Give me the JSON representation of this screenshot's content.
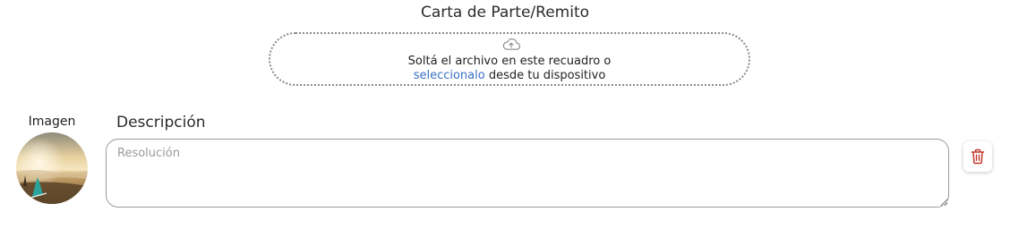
{
  "upload": {
    "title": "Carta de Parte/Remito",
    "icon": "cloud-upload-icon",
    "instruction": "Soltá el archivo en este recuadro o",
    "link_text": "seleccionalo",
    "instruction_suffix": " desde tu dispositivo"
  },
  "image": {
    "label": "Imagen",
    "avatar_icon": "beach-photo-thumbnail"
  },
  "description": {
    "label": "Descripción",
    "placeholder": "Resolución",
    "value": ""
  },
  "actions": {
    "delete_icon": "trash-icon",
    "delete_color": "#c0392b"
  }
}
